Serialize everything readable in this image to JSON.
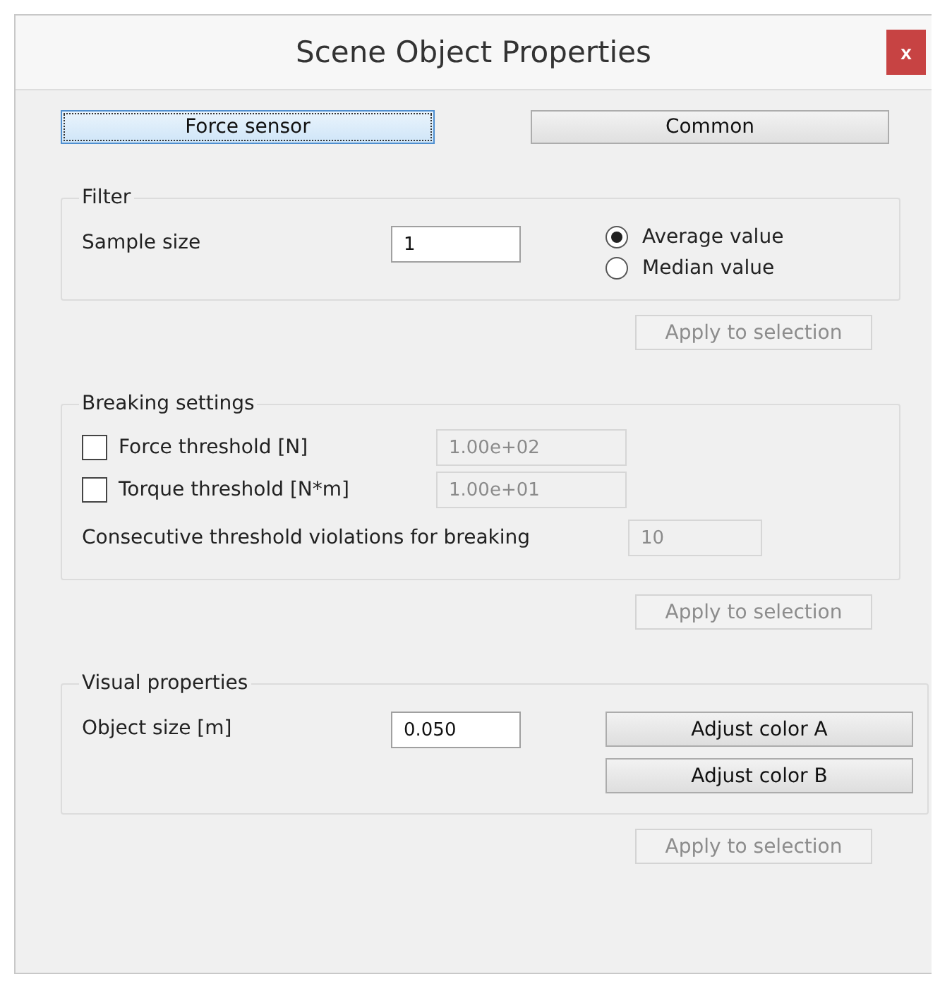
{
  "window": {
    "title": "Scene Object Properties",
    "close": "x"
  },
  "tabs": [
    {
      "label": "Force sensor",
      "selected": true
    },
    {
      "label": "Common",
      "selected": false
    }
  ],
  "filter": {
    "title": "Filter",
    "sample_size": {
      "label": "Sample size",
      "value": "1"
    },
    "options": [
      {
        "label": "Average value",
        "selected": true
      },
      {
        "label": "Median value",
        "selected": false
      }
    ],
    "apply": {
      "label": "Apply to selection",
      "disabled": true
    }
  },
  "breaking": {
    "title": "Breaking settings",
    "thresholds": [
      {
        "label": "Force threshold [N]",
        "checked": false,
        "value": "1.00e+02",
        "disabled": true
      },
      {
        "label": "Torque threshold [N*m]",
        "checked": false,
        "value": "1.00e+01",
        "disabled": true
      }
    ],
    "consecutive": {
      "label": "Consecutive threshold violations for breaking",
      "value": "10",
      "disabled": true
    },
    "apply": {
      "label": "Apply to selection",
      "disabled": true
    }
  },
  "visual": {
    "title": "Visual properties",
    "object_size": {
      "label": "Object size [m]",
      "value": "0.050"
    },
    "buttons": [
      {
        "label": "Adjust color A"
      },
      {
        "label": "Adjust color B"
      }
    ],
    "apply": {
      "label": "Apply to selection",
      "disabled": true
    }
  }
}
